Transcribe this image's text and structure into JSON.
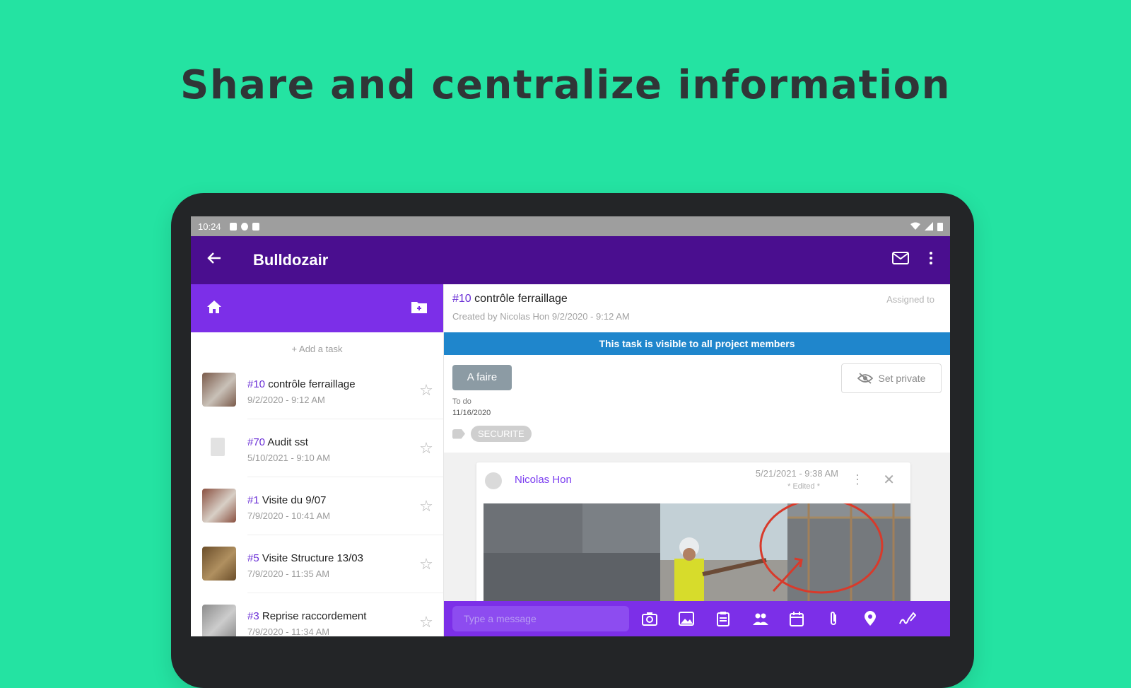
{
  "headline": "Share and centralize information",
  "statusbar": {
    "time": "10:24"
  },
  "appbar": {
    "title": "Bulldozair"
  },
  "tasks_panel": {
    "add_task": "+ Add a task",
    "tasks": [
      {
        "num": "#10",
        "title": "contrôle ferraillage",
        "date": "9/2/2020 - 9:12 AM",
        "has_photo": true
      },
      {
        "num": "#70",
        "title": "Audit sst",
        "date": "5/10/2021 - 9:10 AM",
        "has_photo": false
      },
      {
        "num": "#1",
        "title": "Visite du 9/07",
        "date": "7/9/2020 - 10:41 AM",
        "has_photo": true
      },
      {
        "num": "#5",
        "title": "Visite Structure 13/03",
        "date": "7/9/2020 - 11:35 AM",
        "has_photo": true
      },
      {
        "num": "#3",
        "title": "Reprise raccordement",
        "date": "7/9/2020 - 11:34 AM",
        "has_photo": true
      }
    ]
  },
  "task_detail": {
    "num": "#10",
    "title": "contrôle ferraillage",
    "created": "Created by Nicolas Hon 9/2/2020 - 9:12 AM",
    "assigned": "Assigned to",
    "banner": "This task is visible to all project members",
    "status": "A faire",
    "set_private": "Set private",
    "todo_label": "To do",
    "todo_date": "11/16/2020",
    "tag": "SECURITE"
  },
  "comment": {
    "author": "Nicolas Hon",
    "date": "5/21/2021 - 9:38 AM",
    "edited": "* Edited *"
  },
  "composer": {
    "placeholder": "Type a message"
  },
  "colors": {
    "background": "#24e3a2",
    "appbar": "#4a0e8f",
    "accent": "#7c2fe8",
    "banner": "#1f86cc"
  }
}
